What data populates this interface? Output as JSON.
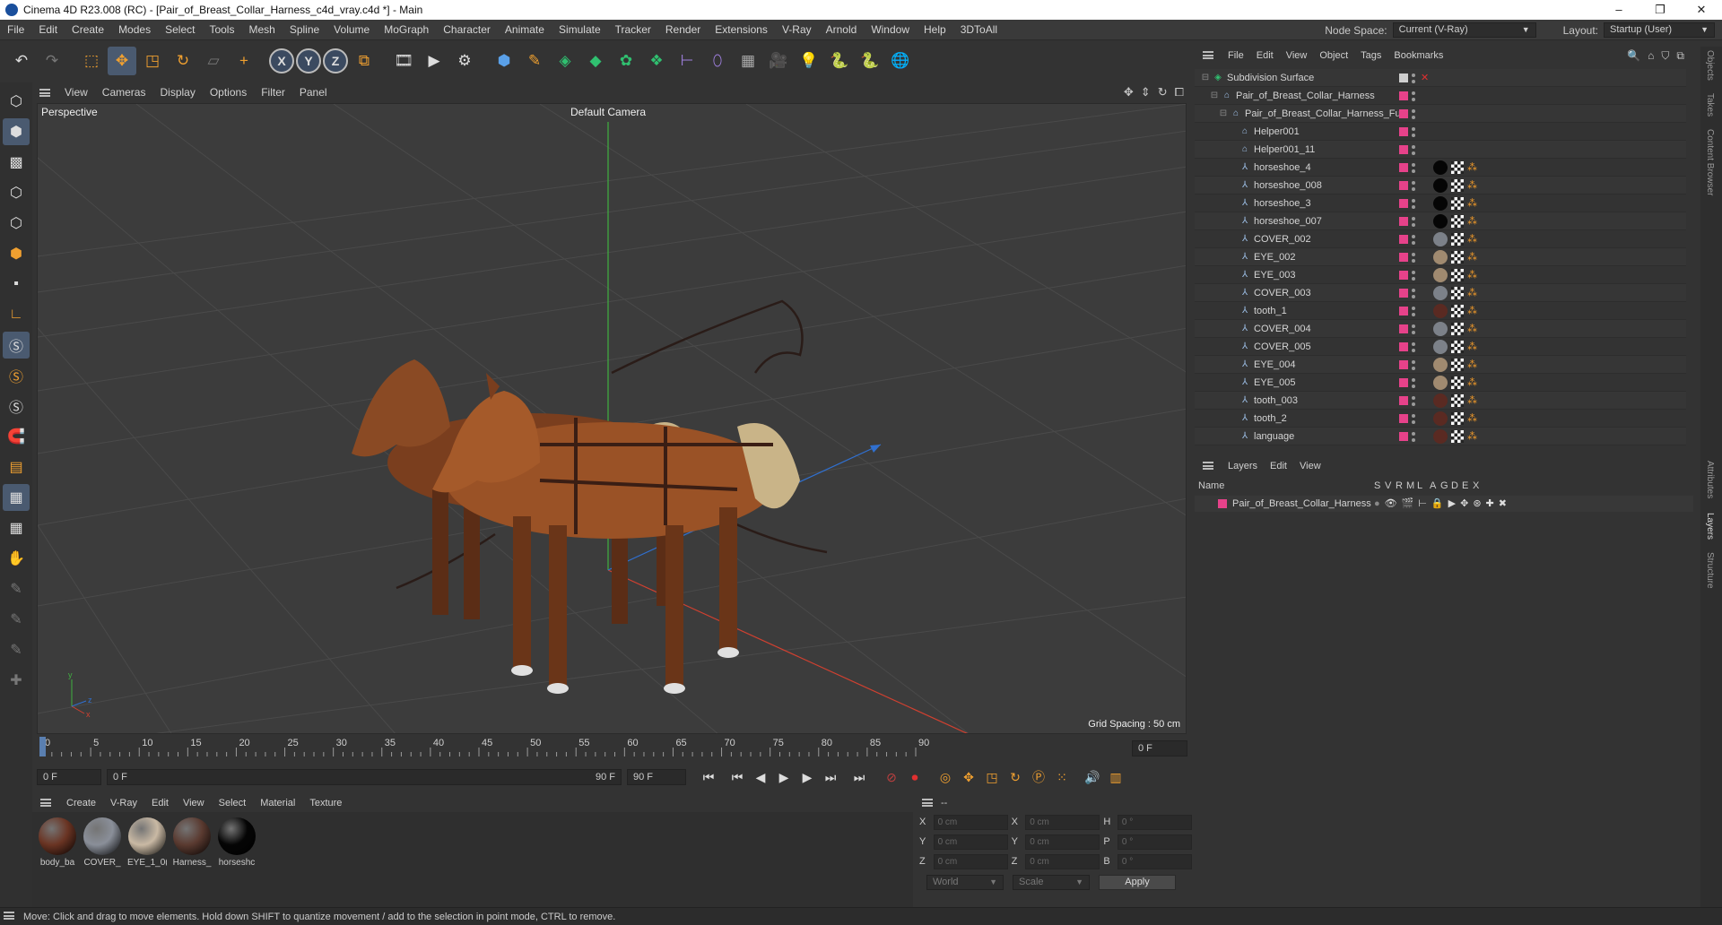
{
  "window": {
    "title": "Cinema 4D R23.008 (RC) - [Pair_of_Breast_Collar_Harness_c4d_vray.c4d *] - Main",
    "controls": [
      "–",
      "❐",
      "✕"
    ]
  },
  "menubar": {
    "items": [
      "File",
      "Edit",
      "Create",
      "Modes",
      "Select",
      "Tools",
      "Mesh",
      "Spline",
      "Volume",
      "MoGraph",
      "Character",
      "Animate",
      "Simulate",
      "Tracker",
      "Render",
      "Extensions",
      "V-Ray",
      "Arnold",
      "Window",
      "Help",
      "3DToAll"
    ],
    "node_space_label": "Node Space:",
    "node_space_value": "Current (V-Ray)",
    "layout_label": "Layout:",
    "layout_value": "Startup (User)"
  },
  "viewport": {
    "menu": [
      "View",
      "Cameras",
      "Display",
      "Options",
      "Filter",
      "Panel"
    ],
    "label": "Perspective",
    "camera": "Default Camera",
    "grid_spacing": "Grid Spacing : 50 cm"
  },
  "timeline": {
    "ticks": [
      "0",
      "5",
      "10",
      "15",
      "20",
      "25",
      "30",
      "35",
      "40",
      "45",
      "50",
      "55",
      "60",
      "65",
      "70",
      "75",
      "80",
      "85",
      "90"
    ],
    "end_field": "0 F"
  },
  "transport": {
    "current_frame": "0 F",
    "range_start": "0 F",
    "range_end": "90 F",
    "max_frame": "90 F"
  },
  "materials": {
    "menu": [
      "Create",
      "V-Ray",
      "Edit",
      "View",
      "Select",
      "Material",
      "Texture"
    ],
    "items": [
      {
        "label": "body_ba",
        "color": "#6a3423"
      },
      {
        "label": "COVER_",
        "color": "#8a8f99"
      },
      {
        "label": "EYE_1_0(",
        "color": "#c9b9a4"
      },
      {
        "label": "Harness_",
        "color": "#5a3a30"
      },
      {
        "label": "horseshc",
        "color": "#050505"
      }
    ]
  },
  "coordinates": {
    "header": "--",
    "rows": [
      {
        "a": "X",
        "av": "0 cm",
        "b": "X",
        "bv": "0 cm",
        "c": "H",
        "cv": "0 °"
      },
      {
        "a": "Y",
        "av": "0 cm",
        "b": "Y",
        "bv": "0 cm",
        "c": "P",
        "cv": "0 °"
      },
      {
        "a": "Z",
        "av": "0 cm",
        "b": "Z",
        "bv": "0 cm",
        "c": "B",
        "cv": "0 °"
      }
    ],
    "space": "World",
    "mode": "Scale",
    "apply": "Apply"
  },
  "status": "Move: Click and drag to move elements. Hold down SHIFT to quantize movement / add to the selection in point mode, CTRL to remove.",
  "object_manager": {
    "menu": [
      "File",
      "Edit",
      "View",
      "Object",
      "Tags",
      "Bookmarks"
    ],
    "objects": [
      {
        "name": "Subdivision Surface",
        "depth": 0,
        "icon": "subdivision-icon",
        "tags": "sds"
      },
      {
        "name": "Pair_of_Breast_Collar_Harness",
        "depth": 1,
        "icon": "null-icon",
        "tags": ""
      },
      {
        "name": "Pair_of_Breast_Collar_Harness_Fur",
        "depth": 2,
        "icon": "null-icon",
        "tags": ""
      },
      {
        "name": "Helper001",
        "depth": 3,
        "icon": "null-icon",
        "tags": ""
      },
      {
        "name": "Helper001_11",
        "depth": 3,
        "icon": "null-icon",
        "tags": ""
      },
      {
        "name": "horseshoe_4",
        "depth": 3,
        "icon": "bone-icon",
        "tags": "mat",
        "mat": "#050505"
      },
      {
        "name": "horseshoe_008",
        "depth": 3,
        "icon": "bone-icon",
        "tags": "mat",
        "mat": "#050505"
      },
      {
        "name": "horseshoe_3",
        "depth": 3,
        "icon": "bone-icon",
        "tags": "mat",
        "mat": "#050505"
      },
      {
        "name": "horseshoe_007",
        "depth": 3,
        "icon": "bone-icon",
        "tags": "mat",
        "mat": "#050505"
      },
      {
        "name": "COVER_002",
        "depth": 3,
        "icon": "bone-icon",
        "tags": "mat",
        "mat": "#7c8189"
      },
      {
        "name": "EYE_002",
        "depth": 3,
        "icon": "bone-icon",
        "tags": "mat",
        "mat": "#a08a70"
      },
      {
        "name": "EYE_003",
        "depth": 3,
        "icon": "bone-icon",
        "tags": "mat",
        "mat": "#a08a70"
      },
      {
        "name": "COVER_003",
        "depth": 3,
        "icon": "bone-icon",
        "tags": "mat",
        "mat": "#7c8189"
      },
      {
        "name": "tooth_1",
        "depth": 3,
        "icon": "bone-icon",
        "tags": "mat",
        "mat": "#5a2a22"
      },
      {
        "name": "COVER_004",
        "depth": 3,
        "icon": "bone-icon",
        "tags": "mat",
        "mat": "#7c8189"
      },
      {
        "name": "COVER_005",
        "depth": 3,
        "icon": "bone-icon",
        "tags": "mat",
        "mat": "#7c8189"
      },
      {
        "name": "EYE_004",
        "depth": 3,
        "icon": "bone-icon",
        "tags": "mat",
        "mat": "#a08a70"
      },
      {
        "name": "EYE_005",
        "depth": 3,
        "icon": "bone-icon",
        "tags": "mat",
        "mat": "#a08a70"
      },
      {
        "name": "tooth_003",
        "depth": 3,
        "icon": "bone-icon",
        "tags": "mat",
        "mat": "#5a2a22"
      },
      {
        "name": "tooth_2",
        "depth": 3,
        "icon": "bone-icon",
        "tags": "mat",
        "mat": "#5a2a22"
      },
      {
        "name": "language",
        "depth": 3,
        "icon": "bone-icon",
        "tags": "mat",
        "mat": "#5a2a22"
      }
    ]
  },
  "side_tabs": [
    "Objects",
    "Takes",
    "Content Browser",
    "Attributes",
    "Layers",
    "Structure"
  ],
  "layers": {
    "menu": [
      "Layers",
      "Edit",
      "View"
    ],
    "columns": [
      "Name",
      "S",
      "V",
      "R",
      "M",
      "L",
      "A",
      "G",
      "D",
      "E",
      "X"
    ],
    "rows": [
      {
        "name": "Pair_of_Breast_Collar_Harness",
        "color": "#e6428a"
      }
    ]
  },
  "colors": {
    "accent": "#4a5a70",
    "layer": "#e6428a",
    "axis_x": "#d04030",
    "axis_y": "#40b040",
    "axis_z": "#3070d0"
  }
}
